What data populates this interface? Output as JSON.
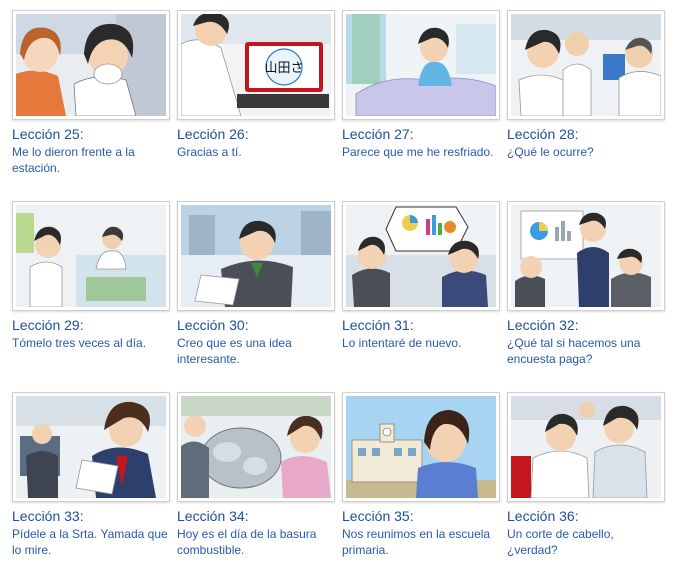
{
  "lessons": [
    {
      "title": "Lección 25:",
      "desc": "Me lo dieron frente a la estación."
    },
    {
      "title": "Lección 26:",
      "desc": "Gracias a tí."
    },
    {
      "title": "Lección 27:",
      "desc": "Parece que me he resfriado."
    },
    {
      "title": "Lección 28:",
      "desc": "¿Qué le ocurre?"
    },
    {
      "title": "Lección 29:",
      "desc": "Tómelo tres veces al día."
    },
    {
      "title": "Lección 30:",
      "desc": "Creo que es una idea interesante."
    },
    {
      "title": "Lección 31:",
      "desc": "Lo intentaré de nuevo."
    },
    {
      "title": "Lección 32:",
      "desc": "¿Qué tal si hacemos una encuesta paga?"
    },
    {
      "title": "Lección 33:",
      "desc": "Pídele a la Srta. Yamada que lo mire."
    },
    {
      "title": "Lección 34:",
      "desc": "Hoy es el día de la basura combustible."
    },
    {
      "title": "Lección 35:",
      "desc": "Nos reunimos en la escuela primaria."
    },
    {
      "title": "Lección 36:",
      "desc": "Un corte de cabello, ¿verdad?"
    }
  ],
  "thumb_texts": {
    "l26_screen": "山田さ"
  },
  "colors": {
    "link": "#1e4f9c",
    "border": "#cfcfcf"
  }
}
